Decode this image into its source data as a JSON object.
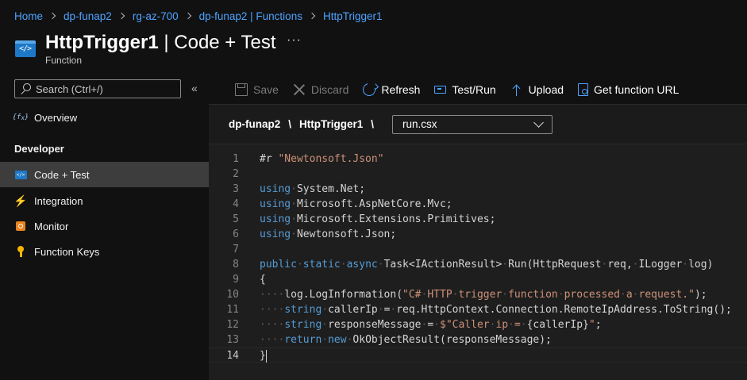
{
  "breadcrumb": [
    "Home",
    "dp-funap2",
    "rg-az-700",
    "dp-funap2 | Functions",
    "HttpTrigger1"
  ],
  "header": {
    "title_bold": "HttpTrigger1",
    "title_rest": " | Code + Test",
    "more": "···",
    "subtitle": "Function"
  },
  "sidebar": {
    "search_placeholder": "Search (Ctrl+/)",
    "collapse": "«",
    "overview": "Overview",
    "section": "Developer",
    "items": [
      "Code + Test",
      "Integration",
      "Monitor",
      "Function Keys"
    ]
  },
  "toolbar": {
    "save": "Save",
    "discard": "Discard",
    "refresh": "Refresh",
    "test_run": "Test/Run",
    "upload": "Upload",
    "get_url": "Get function URL"
  },
  "path": {
    "app": "dp-funap2",
    "sep": "\\",
    "function": "HttpTrigger1",
    "file": "run.csx"
  },
  "editor": {
    "current_line": 14,
    "lines": [
      [
        [
          "t",
          "#r "
        ],
        [
          "s",
          "\"Newtonsoft.Json\""
        ]
      ],
      [],
      [
        [
          "k",
          "using"
        ],
        [
          "w",
          "·"
        ],
        [
          "t",
          "System.Net;"
        ]
      ],
      [
        [
          "k",
          "using"
        ],
        [
          "w",
          "·"
        ],
        [
          "t",
          "Microsoft.AspNetCore.Mvc;"
        ]
      ],
      [
        [
          "k",
          "using"
        ],
        [
          "w",
          "·"
        ],
        [
          "t",
          "Microsoft.Extensions.Primitives;"
        ]
      ],
      [
        [
          "k",
          "using"
        ],
        [
          "w",
          "·"
        ],
        [
          "t",
          "Newtonsoft.Json;"
        ]
      ],
      [],
      [
        [
          "k",
          "public"
        ],
        [
          "w",
          "·"
        ],
        [
          "k",
          "static"
        ],
        [
          "w",
          "·"
        ],
        [
          "k",
          "async"
        ],
        [
          "w",
          "·"
        ],
        [
          "t",
          "Task<IActionResult>"
        ],
        [
          "w",
          "·"
        ],
        [
          "t",
          "Run(HttpRequest"
        ],
        [
          "w",
          "·"
        ],
        [
          "t",
          "req,"
        ],
        [
          "w",
          "·"
        ],
        [
          "t",
          "ILogger"
        ],
        [
          "w",
          "·"
        ],
        [
          "t",
          "log)"
        ]
      ],
      [
        [
          "t",
          "{"
        ]
      ],
      [
        [
          "w",
          "····"
        ],
        [
          "t",
          "log.LogInformation("
        ],
        [
          "s",
          "\"C#"
        ],
        [
          "w",
          "·"
        ],
        [
          "s",
          "HTTP"
        ],
        [
          "w",
          "·"
        ],
        [
          "s",
          "trigger"
        ],
        [
          "w",
          "·"
        ],
        [
          "s",
          "function"
        ],
        [
          "w",
          "·"
        ],
        [
          "s",
          "processed"
        ],
        [
          "w",
          "·"
        ],
        [
          "s",
          "a"
        ],
        [
          "w",
          "·"
        ],
        [
          "s",
          "request.\""
        ],
        [
          "t",
          ");"
        ]
      ],
      [
        [
          "w",
          "····"
        ],
        [
          "k",
          "string"
        ],
        [
          "w",
          "·"
        ],
        [
          "t",
          "callerIp"
        ],
        [
          "w",
          "·"
        ],
        [
          "t",
          "="
        ],
        [
          "w",
          "·"
        ],
        [
          "t",
          "req.HttpContext.Connection.RemoteIpAddress.ToString();"
        ]
      ],
      [
        [
          "w",
          "····"
        ],
        [
          "k",
          "string"
        ],
        [
          "w",
          "·"
        ],
        [
          "t",
          "responseMessage"
        ],
        [
          "w",
          "·"
        ],
        [
          "t",
          "="
        ],
        [
          "w",
          "·"
        ],
        [
          "s",
          "$\"Caller"
        ],
        [
          "w",
          "·"
        ],
        [
          "s",
          "ip"
        ],
        [
          "w",
          "·"
        ],
        [
          "s",
          "="
        ],
        [
          "w",
          "·"
        ],
        [
          "t",
          "{callerIp}"
        ],
        [
          "s",
          "\""
        ],
        [
          "t",
          ";"
        ]
      ],
      [
        [
          "w",
          "····"
        ],
        [
          "k",
          "return"
        ],
        [
          "w",
          "·"
        ],
        [
          "k",
          "new"
        ],
        [
          "w",
          "·"
        ],
        [
          "t",
          "OkObjectResult(responseMessage);"
        ]
      ],
      [
        [
          "t",
          "}"
        ]
      ]
    ]
  }
}
